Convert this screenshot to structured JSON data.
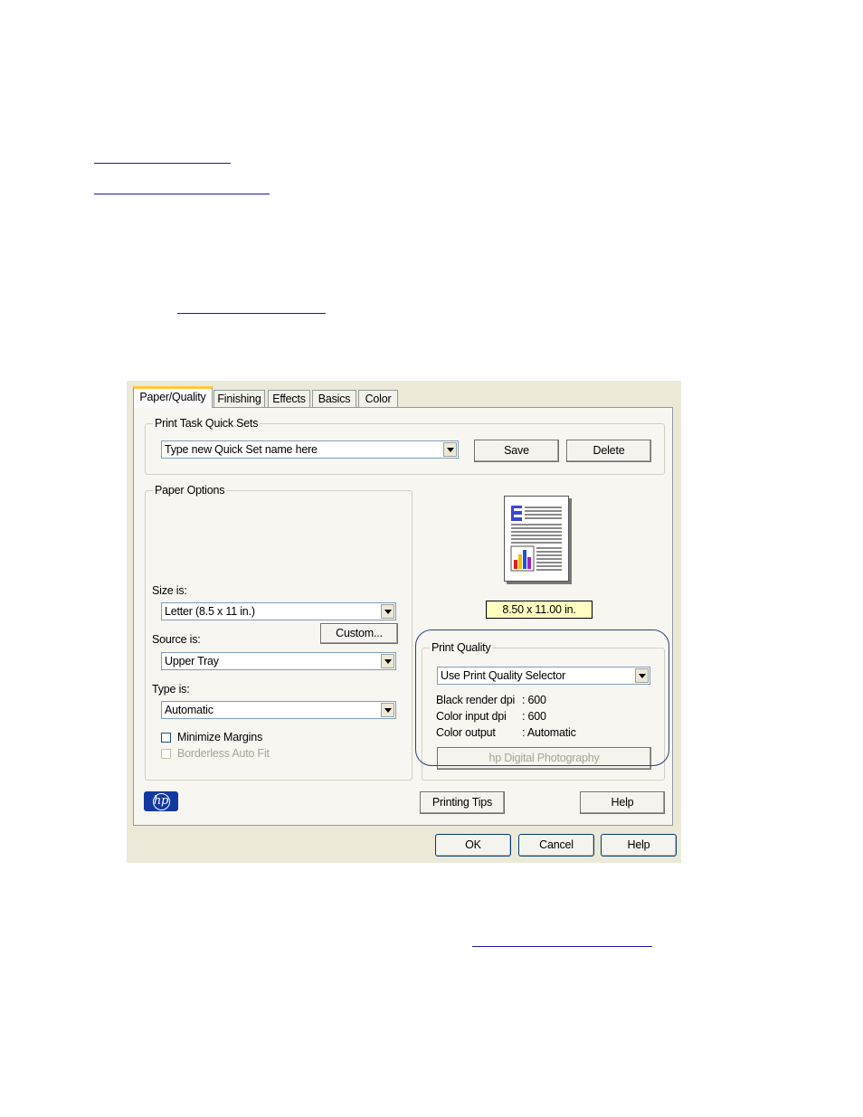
{
  "document": {
    "links": [
      "",
      "",
      "",
      ""
    ]
  },
  "dialog": {
    "tabs": [
      {
        "label": "Paper/Quality",
        "active": true
      },
      {
        "label": "Finishing",
        "active": false
      },
      {
        "label": "Effects",
        "active": false
      },
      {
        "label": "Basics",
        "active": false
      },
      {
        "label": "Color",
        "active": false
      }
    ],
    "quick_sets": {
      "title": "Print Task Quick Sets",
      "value": "Type new Quick Set name here",
      "save_label": "Save",
      "delete_label": "Delete"
    },
    "paper_options": {
      "title": "Paper Options",
      "size_label": "Size is:",
      "size_value": "Letter (8.5 x 11 in.)",
      "custom_label": "Custom...",
      "source_label": "Source is:",
      "source_value": "Upper Tray",
      "type_label": "Type is:",
      "type_value": "Automatic",
      "minimize_margins_label": "Minimize Margins",
      "borderless_label": "Borderless Auto Fit"
    },
    "preview": {
      "size_text": "8.50 x 11.00 in."
    },
    "print_quality": {
      "title": "Print Quality",
      "value": "Use Print Quality Selector",
      "black_dpi_label": "Black render dpi",
      "black_dpi_value": ": 600",
      "color_dpi_label": "Color input dpi",
      "color_dpi_value": ": 600",
      "color_output_label": "Color output",
      "color_output_value": ": Automatic",
      "photo_button_label": "hp Digital Photography"
    },
    "footer": {
      "logo_text": "hp",
      "printing_tips_label": "Printing Tips",
      "help_label": "Help"
    },
    "buttons": {
      "ok_label": "OK",
      "cancel_label": "Cancel",
      "help_label": "Help"
    },
    "colors": {
      "dialog_bg": "#ece9d8",
      "panel_bg": "#f7f6f0",
      "active_tab_accent": "#ffc83c",
      "highlight_ring": "#2d3f88",
      "hp_blue": "#13399f",
      "size_badge_bg": "#ffffc0"
    }
  }
}
